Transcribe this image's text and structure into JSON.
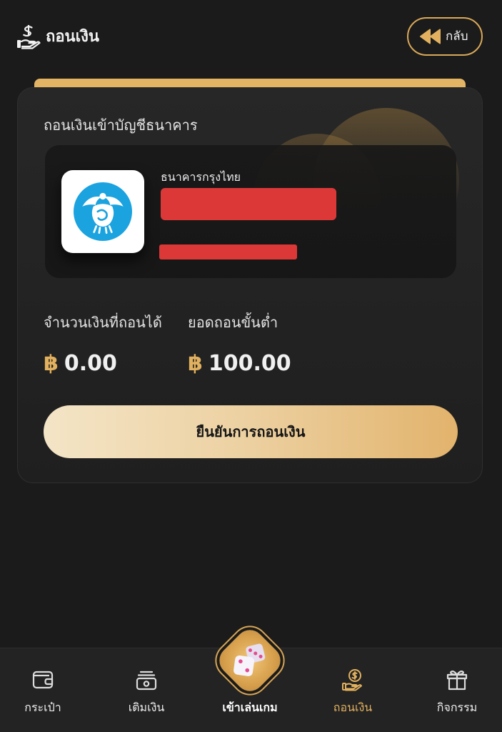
{
  "header": {
    "icon": "withdraw-hand-icon",
    "title": "ถอนเงิน",
    "back_icon": "rewind-icon",
    "back_label": "กลับ"
  },
  "card": {
    "title": "ถอนเงินเข้าบัญชีธนาคาร",
    "bank": {
      "logo": "krungthai-bank-logo",
      "name": "ธนาคารกรุงไทย"
    },
    "stats": [
      {
        "label": "จำนวนเงินที่ถอนได้",
        "currency": "฿",
        "value": "0.00"
      },
      {
        "label": "ยอดถอนขั้นต่ำ",
        "currency": "฿",
        "value": "100.00"
      }
    ],
    "confirm_label": "ยืนยันการถอนเงิน"
  },
  "nav": {
    "items": [
      {
        "label": "กระเป๋า",
        "icon": "wallet-icon",
        "active": false
      },
      {
        "label": "เติมเงิน",
        "icon": "cash-icon",
        "active": false
      },
      {
        "label": "เข้าเล่นเกม",
        "icon": "dice-icon",
        "active": false
      },
      {
        "label": "ถอนเงิน",
        "icon": "hand-coin-icon",
        "active": true
      },
      {
        "label": "กิจกรรม",
        "icon": "gift-icon",
        "active": false
      }
    ]
  },
  "colors": {
    "accent": "#e2b15f",
    "background": "#1b1b1b",
    "bank_logo": "#1ba3e0",
    "redaction": "#dc3838"
  }
}
